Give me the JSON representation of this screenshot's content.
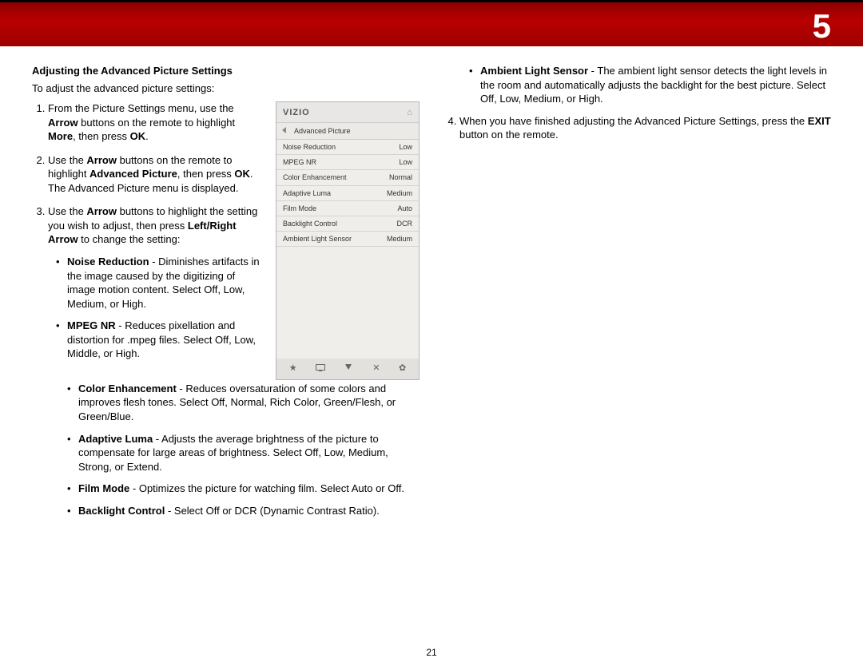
{
  "chapter": "5",
  "page": "21",
  "heading": "Adjusting the Advanced Picture Settings",
  "intro": "To adjust the advanced picture settings:",
  "step1": {
    "a": "From the Picture Settings menu, use the ",
    "b": "Arrow",
    "c": " buttons on the remote to highlight ",
    "d": "More",
    "e": ", then press ",
    "f": "OK",
    "g": "."
  },
  "step2": {
    "a": "Use the ",
    "b": "Arrow",
    "c": " buttons on the remote to highlight ",
    "d": "Advanced Picture",
    "e": ", then press ",
    "f": "OK",
    "g": ". The Advanced Picture menu is displayed."
  },
  "step3": {
    "a": "Use the ",
    "b": "Arrow",
    "c": " buttons to highlight the setting you wish to adjust, then press ",
    "d": "Left/Right Arrow",
    "e": " to change the setting:"
  },
  "bullet_nr": {
    "t": "Noise Reduction",
    "d": " - Diminishes artifacts in the image caused by the digitizing of image motion content. Select Off, Low, Medium, or High."
  },
  "bullet_mpeg": {
    "t": "MPEG NR",
    "d": " - Reduces pixellation and distortion for .mpeg files. Select Off, Low, Middle, or High."
  },
  "bullet_ce": {
    "t": "Color Enhancement",
    "d": " - Reduces oversaturation of some colors and improves flesh tones. Select Off, Normal, Rich Color, Green/Flesh, or Green/Blue."
  },
  "bullet_al": {
    "t": "Adaptive Luma",
    "d": " - Adjusts the average brightness of the picture to compensate for large areas of brightness. Select Off, Low, Medium, Strong, or Extend."
  },
  "bullet_fm": {
    "t": "Film Mode",
    "d": " - Optimizes the picture for watching film. Select Auto or Off."
  },
  "bullet_bc": {
    "t": "Backlight Control",
    "d": " - Select Off or DCR (Dynamic Contrast Ratio)."
  },
  "bullet_als": {
    "t": "Ambient Light Sensor",
    "d": " - The ambient light sensor detects the light levels in the room and automatically adjusts the backlight for the best picture. Select Off, Low, Medium, or High."
  },
  "step4": {
    "a": "When you have finished adjusting the Advanced Picture Settings, press the ",
    "b": "EXIT",
    "c": " button on the remote."
  },
  "osd": {
    "logo": "VIZIO",
    "title": "Advanced Picture",
    "rows": [
      {
        "l": "Noise Reduction",
        "v": "Low"
      },
      {
        "l": "MPEG NR",
        "v": "Low"
      },
      {
        "l": "Color Enhancement",
        "v": "Normal"
      },
      {
        "l": "Adaptive Luma",
        "v": "Medium"
      },
      {
        "l": "Film Mode",
        "v": "Auto"
      },
      {
        "l": "Backlight Control",
        "v": "DCR"
      },
      {
        "l": "Ambient Light Sensor",
        "v": "Medium"
      }
    ]
  }
}
